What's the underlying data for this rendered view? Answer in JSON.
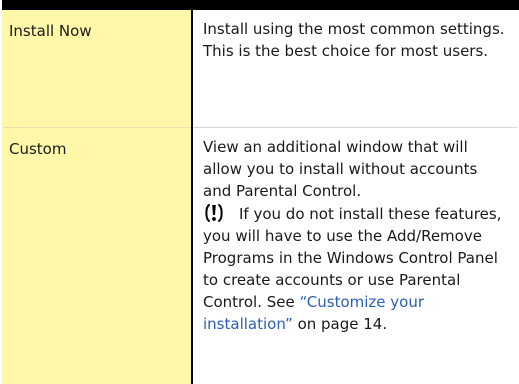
{
  "colors": {
    "name_column_bg": "#fff8a8",
    "rule": "#000000",
    "link": "#2a5fb8"
  },
  "table": {
    "rows": [
      {
        "name": "Install Now",
        "description": "Install using the most common settings. This is the best choice for most users."
      },
      {
        "name": "Custom",
        "description": "View an additional window that will allow you to install without accounts and Parental Control.",
        "note": {
          "icon": "warning-icon",
          "text": "If you do not install these features, you will have to use the Add/Remove Programs in the Windows Control Panel to create accounts or use Parental Control. See",
          "link_text": "“Customize your installation”",
          "trailing_text": "on page 14."
        }
      }
    ]
  }
}
